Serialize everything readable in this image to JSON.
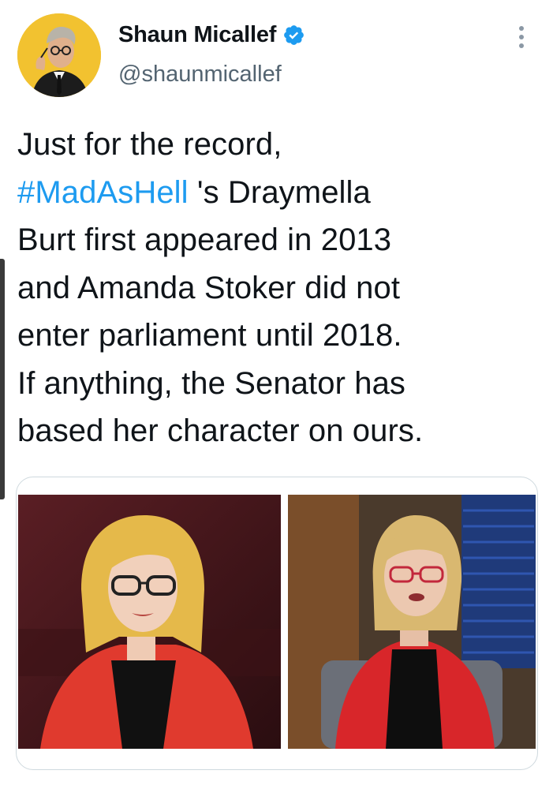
{
  "tweet": {
    "author": {
      "display_name": "Shaun Micallef",
      "handle": "@shaunmicallef",
      "verified_icon": "verified-badge-icon",
      "avatar_bg": "#f2c230"
    },
    "text_before_hashtag": "Just for the record,",
    "hashtag": "#MadAsHell",
    "text_after_hashtag": " 's Draymella\nBurt first appeared in 2013\nand Amanda Stoker did not\nenter parliament until 2018.\nIf anything, the Senator has\nbased her character on ours.",
    "colors": {
      "hashtag": "#1d9bf0",
      "verified": "#1d9bf0",
      "text": "#0f1419",
      "handle": "#536471"
    },
    "media": {
      "count": 2,
      "items": [
        "photo",
        "photo"
      ]
    },
    "more_icon": "more-vertical-icon"
  }
}
